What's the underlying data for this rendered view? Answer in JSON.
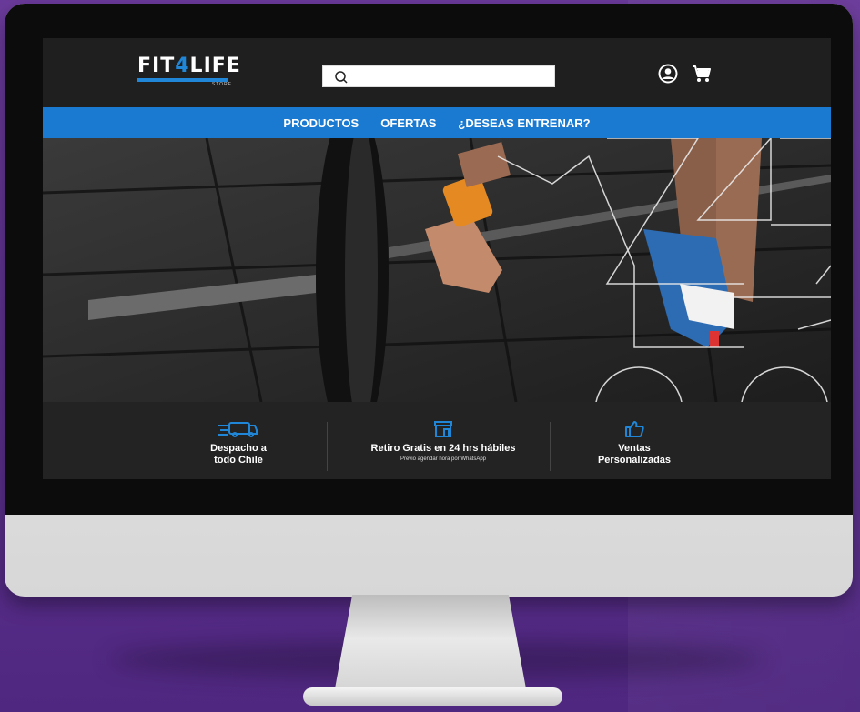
{
  "brand": {
    "logo_prefix": "FIT",
    "logo_mid": "4",
    "logo_suffix": "LIFE",
    "logo_sub": "STORE",
    "accent_color": "#1f86d8",
    "nav_color": "#1a7ad1"
  },
  "header": {
    "search": {
      "placeholder": "",
      "value": ""
    },
    "icons": [
      "search-icon",
      "user-icon",
      "cart-icon"
    ]
  },
  "nav": {
    "items": [
      {
        "label": "PRODUCTOS"
      },
      {
        "label": "OFERTAS"
      },
      {
        "label": "¿DESEAS ENTRENAR?"
      }
    ]
  },
  "features": [
    {
      "icon": "delivery-van-icon",
      "title_line1": "Despacho a",
      "title_line2": "todo Chile"
    },
    {
      "icon": "store-icon",
      "title_line1": "Retiro Gratis en 24 hrs hábiles",
      "subtitle": "Previo agendar hora por WhatsApp"
    },
    {
      "icon": "thumbs-up-icon",
      "title_line1": "Ventas",
      "title_line2": "Personalizadas"
    }
  ]
}
